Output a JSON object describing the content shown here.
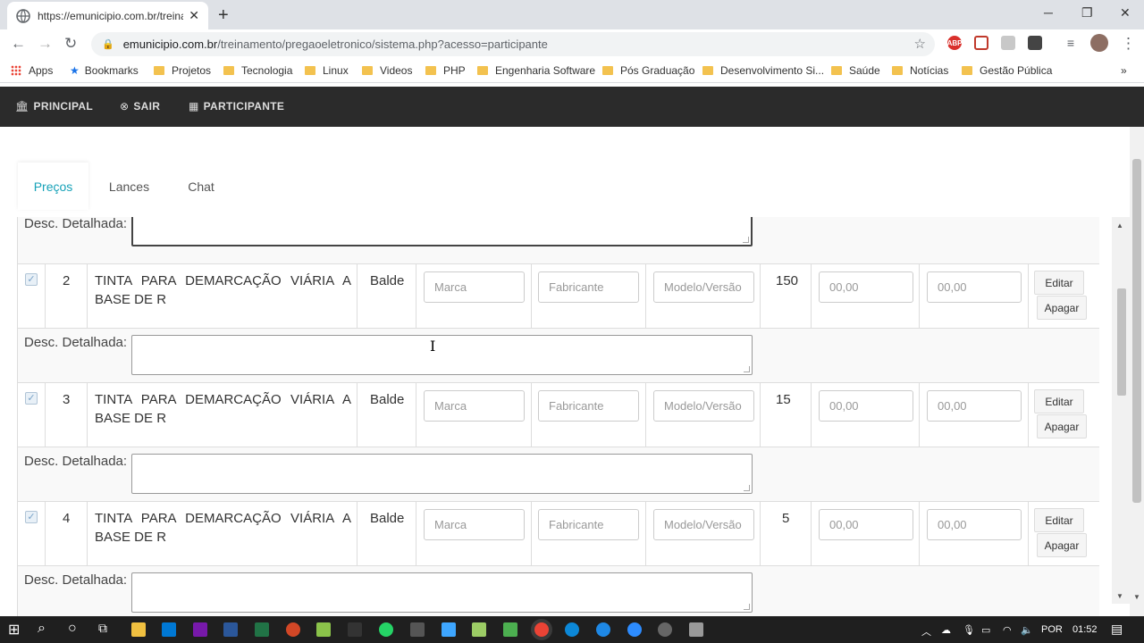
{
  "browser": {
    "tab_title": "https://emunicipio.com.br/treina",
    "new_tab": "+",
    "url_host": "emunicipio.com.br",
    "url_path": "/treinamento/pregaoeletronico/sistema.php?acesso=participante",
    "bookmarks": [
      "Apps",
      "Bookmarks",
      "Projetos",
      "Tecnologia",
      "Linux",
      "Videos",
      "PHP",
      "Engenharia Software",
      "Pós Graduação",
      "Desenvolvimento Si...",
      "Saúde",
      "Notícias",
      "Gestão Pública"
    ],
    "more_bookmarks": "»",
    "extensions": [
      "ABP"
    ]
  },
  "nav": {
    "principal": "PRINCIPAL",
    "sair": "SAIR",
    "participante": "PARTICIPANTE"
  },
  "tabs": [
    "Preços",
    "Lances",
    "Chat"
  ],
  "desc_label": "Desc. Detalhada:",
  "placeholders": {
    "marca": "Marca",
    "fabricante": "Fabricante",
    "modelo": "Modelo/Versão",
    "price": "00,00"
  },
  "buttons": {
    "editar": "Editar",
    "apagar": "Apagar"
  },
  "items": [
    {
      "num": "2",
      "description": "TINTA PARA DEMARCAÇÃO VIÁRIA A BASE DE R",
      "unit": "Balde",
      "qty": "150",
      "checked": true
    },
    {
      "num": "3",
      "description": "TINTA PARA DEMARCAÇÃO VIÁRIA A BASE DE R",
      "unit": "Balde",
      "qty": "15",
      "checked": true
    },
    {
      "num": "4",
      "description": "TINTA PARA DEMARCAÇÃO VIÁRIA A BASE DE R",
      "unit": "Balde",
      "qty": "5",
      "checked": true
    }
  ],
  "taskbar": {
    "language": "POR",
    "time": "01:52"
  }
}
